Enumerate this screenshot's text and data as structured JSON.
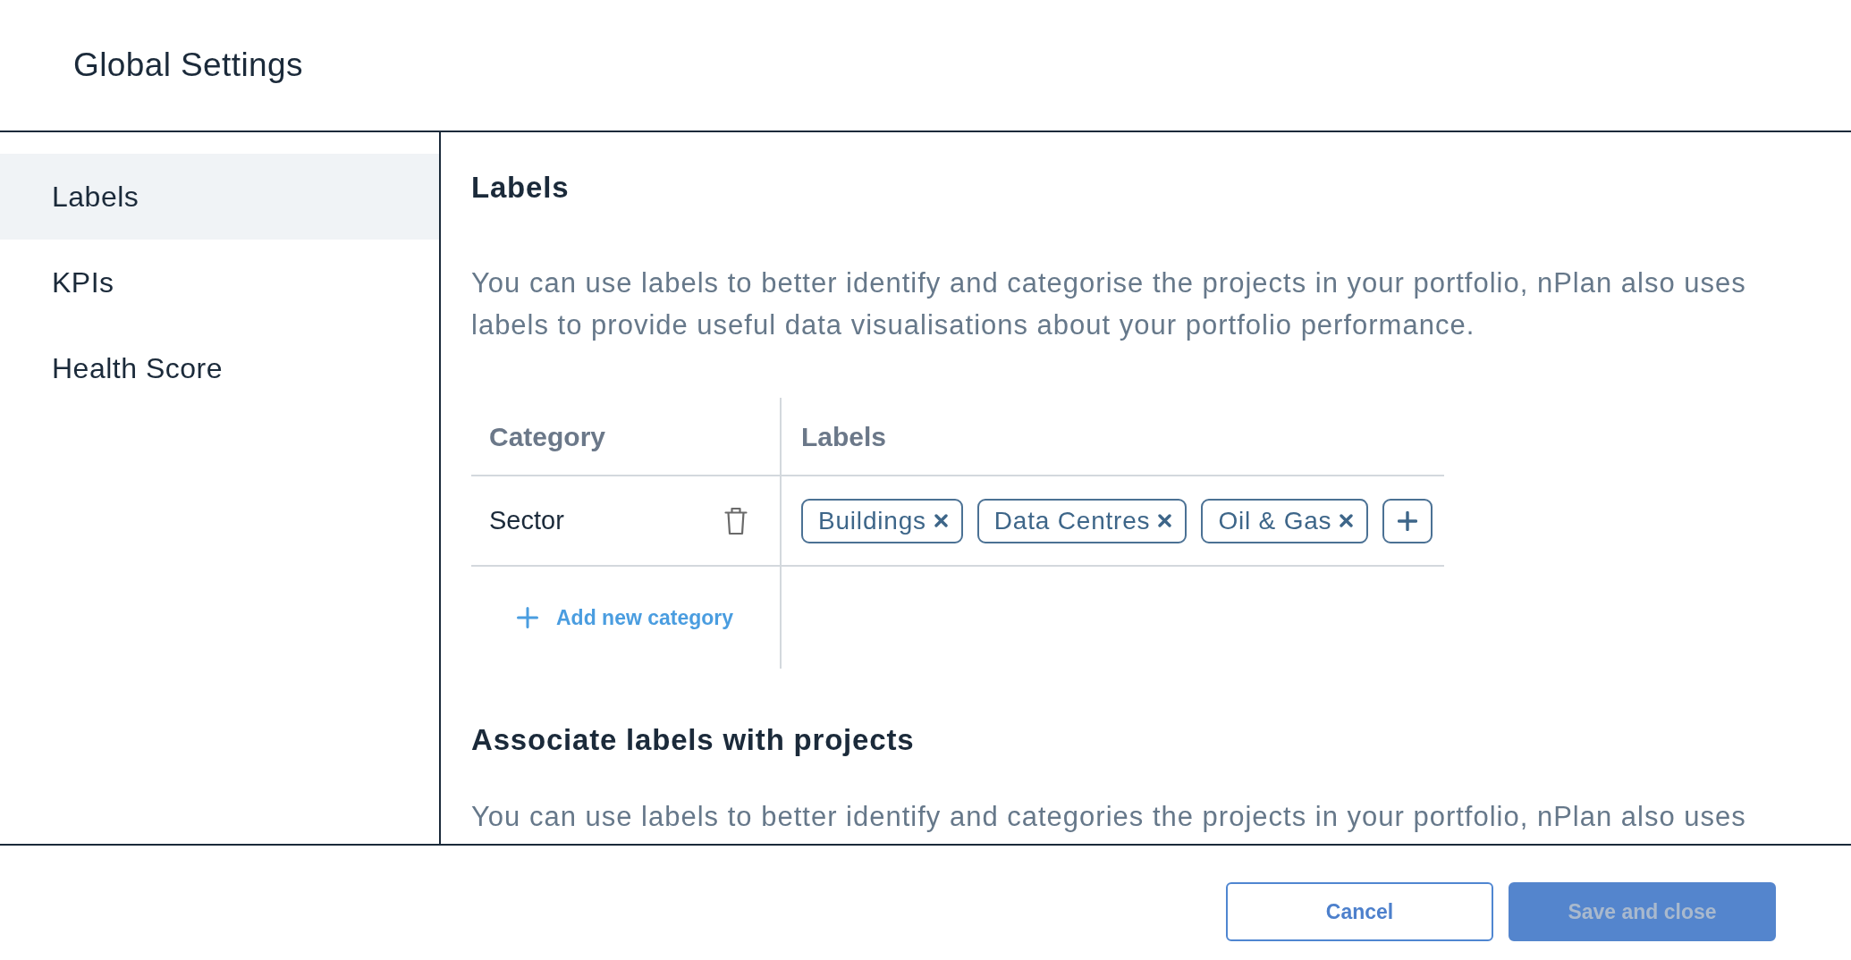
{
  "window": {
    "title": "Global Settings"
  },
  "sidebar": {
    "items": [
      {
        "label": "Labels",
        "selected": true
      },
      {
        "label": "KPIs",
        "selected": false
      },
      {
        "label": "Health Score",
        "selected": false
      }
    ]
  },
  "sections": [
    {
      "heading": "Labels",
      "description": "You can use labels to better identify and categorise the projects in your portfolio, nPlan also uses labels to provide useful data visualisations about your portfolio performance.",
      "table": {
        "columns": [
          "Category",
          "Labels"
        ],
        "rows": [
          {
            "category": "Sector",
            "labels": [
              "Buildings",
              "Data Centres",
              "Oil & Gas"
            ]
          }
        ],
        "add_button": "Add new category"
      }
    },
    {
      "heading": "Associate labels with projects",
      "description": "You can use labels to better identify and categories the projects in your portfolio, nPlan also uses"
    }
  ],
  "footer": {
    "buttons": [
      {
        "label": "Cancel",
        "kind": "secondary",
        "disabled": false
      },
      {
        "label": "Save and close",
        "kind": "primary",
        "disabled": true
      }
    ]
  }
}
